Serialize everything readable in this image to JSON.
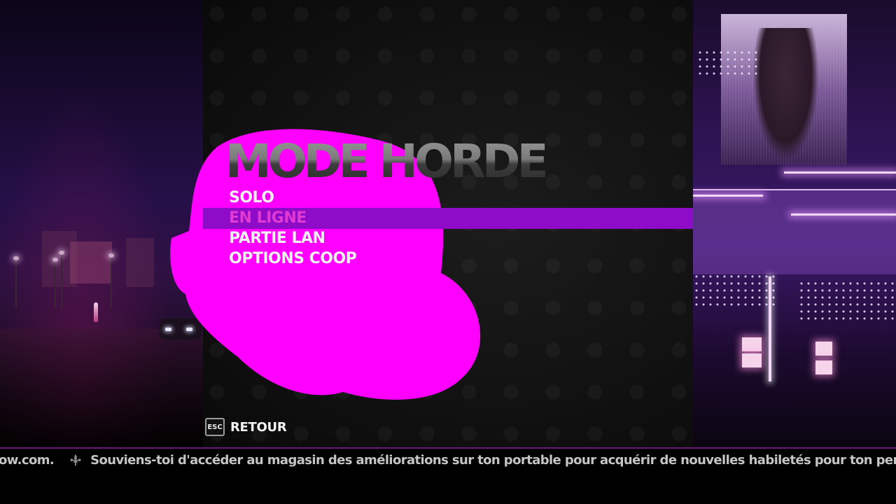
{
  "menu": {
    "title": "MODE HORDE",
    "items": [
      {
        "label": "SOLO",
        "selected": false
      },
      {
        "label": "EN LIGNE",
        "selected": true
      },
      {
        "label": "PARTIE LAN",
        "selected": false
      },
      {
        "label": "OPTIONS COOP",
        "selected": false
      }
    ],
    "selected_color": "#8e0bc7"
  },
  "back_hint": {
    "key": "ESC",
    "label": "RETOUR"
  },
  "ticker": {
    "previous_tail": "ow.com.",
    "message": "Souviens-toi d'accéder au magasin des améliorations sur ton portable pour acquérir de nouvelles habiletés pour ton personnag",
    "separator_icon": "fleur-de-lis-icon"
  },
  "colors": {
    "blob": "#ff00ff",
    "accent_purple": "#8e0bc7",
    "selected_text": "#e13ad2"
  }
}
